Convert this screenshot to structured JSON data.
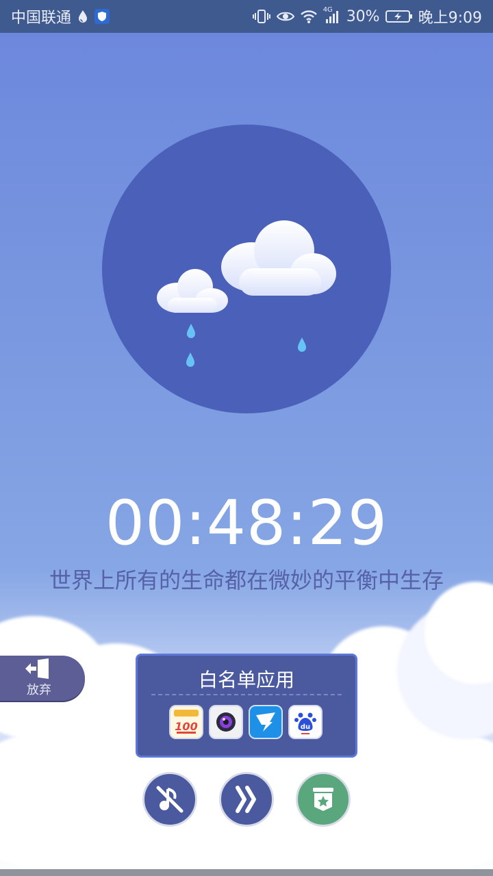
{
  "status_bar": {
    "carrier": "中国联通",
    "network": "4G",
    "battery": "30%",
    "time": "晚上9:09"
  },
  "timer": "00:48:29",
  "quote": "世界上所有的生命都在微妙的平衡中生存",
  "give_up": {
    "label": "放弃",
    "icon": "exit-door-icon"
  },
  "whitelist": {
    "title": "白名单应用",
    "apps": [
      {
        "name": "作业帮100",
        "icon": "homework-100-icon",
        "text": "100"
      },
      {
        "name": "camera",
        "icon": "camera-app-icon"
      },
      {
        "name": "dingtalk",
        "icon": "dingtalk-app-icon"
      },
      {
        "name": "baidu",
        "icon": "baidu-app-icon",
        "text": "du"
      }
    ]
  },
  "buttons": [
    {
      "icon": "music-off-icon"
    },
    {
      "icon": "focus-mode-icon"
    },
    {
      "icon": "star-box-icon"
    }
  ],
  "colors": {
    "status_bar": "#3f5a8e",
    "circle": "#4b60b8",
    "panel": "#4b5a9f",
    "give_up": "#5c5e95",
    "accent_green": "#5aa67d"
  }
}
